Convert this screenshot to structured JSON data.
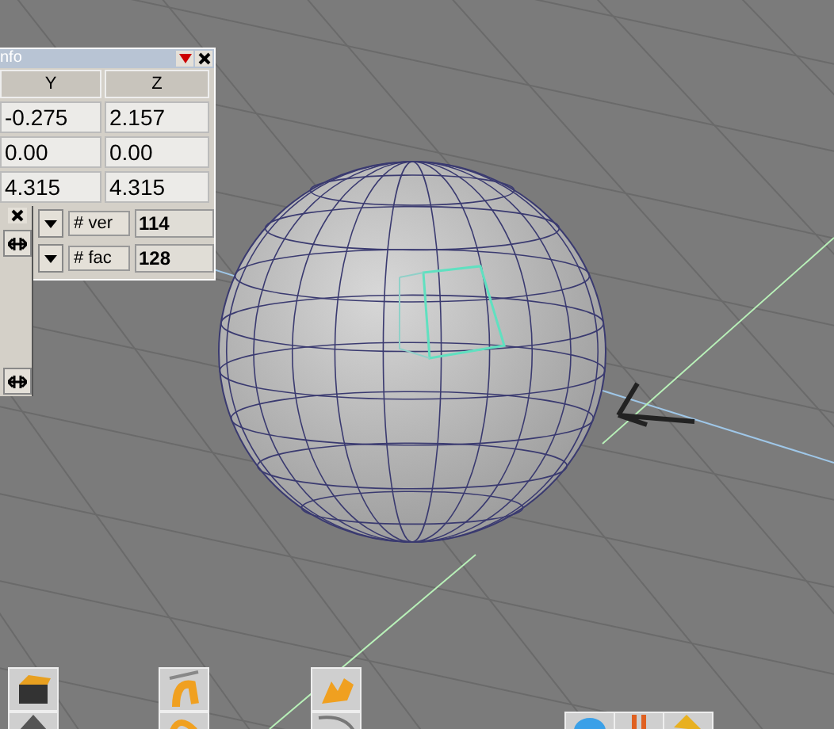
{
  "info_panel": {
    "title": "nfo",
    "columns": [
      "Y",
      "Z"
    ],
    "rows": [
      [
        "-0.275",
        "2.157"
      ],
      [
        "0.00",
        "0.00"
      ],
      [
        "4.315",
        "4.315"
      ]
    ],
    "stats": [
      {
        "label": "# ver",
        "value": "114"
      },
      {
        "label": "# fac",
        "value": "128"
      }
    ]
  }
}
